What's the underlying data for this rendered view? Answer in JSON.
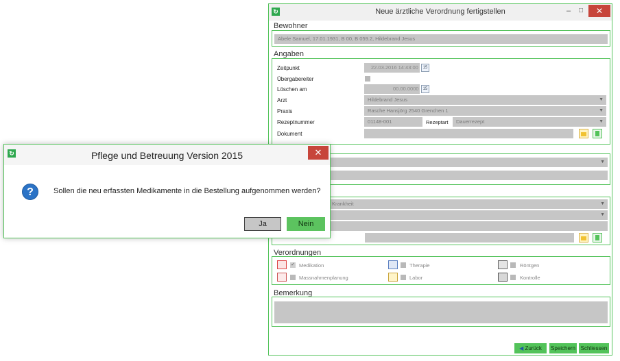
{
  "main_window": {
    "title": "Neue ärztliche Verordnung fertigstellen",
    "controls": {
      "minimize": "–",
      "maximize": "□",
      "close": "✕"
    },
    "bewohner": {
      "section_title": "Bewohner",
      "value": "Abele Samuel, 17.01.1931, B 00, B 059.2, Hildebrand Jesus"
    },
    "angaben": {
      "section_title": "Angaben",
      "zeitpunkt_label": "Zeitpunkt",
      "zeitpunkt_value": "22.03.2016 14:43:00",
      "uebergabebereit_label": "Übergabereiter",
      "loeschen_label": "Löschen am",
      "loeschen_value": "00.00.0000",
      "arzt_label": "Arzt",
      "arzt_value": "Hildebrand Jesus",
      "praxis_label": "Praxis",
      "praxis_value": "Rasche Hansjörg   2540 Grenchen 1",
      "rezeptnummer_label": "Rezeptnummer",
      "rezeptnummer_value": "01148-001",
      "rezeptart_label": "Rezeptart",
      "rezeptart_value": "Dauerrezept",
      "dokument_label": "Dokument"
    },
    "hidden_section": {
      "krankheit_value": "Krankheit"
    },
    "verordnungen": {
      "section_title": "Verordnungen",
      "items": [
        {
          "label": "Medikation"
        },
        {
          "label": "Therapie"
        },
        {
          "label": "Röntgen"
        },
        {
          "label": "Massnahmenplanung"
        },
        {
          "label": "Labor"
        },
        {
          "label": "Kontrolle"
        }
      ]
    },
    "bemerkung": {
      "section_title": "Bemerkung"
    },
    "buttons": {
      "zurueck": "Zurück",
      "speichern": "Speichern",
      "schliessen": "Schliessen"
    }
  },
  "dialog": {
    "title": "Pflege und Betreuung Version 2015",
    "message": "Sollen die neu erfassten Medikamente in die Bestellung aufgenommen werden?",
    "yes_label": "Ja",
    "no_label": "Nein",
    "close": "✕"
  },
  "colors": {
    "accent": "#53c35a",
    "close": "#c7453b",
    "field": "#c6c6c6"
  }
}
